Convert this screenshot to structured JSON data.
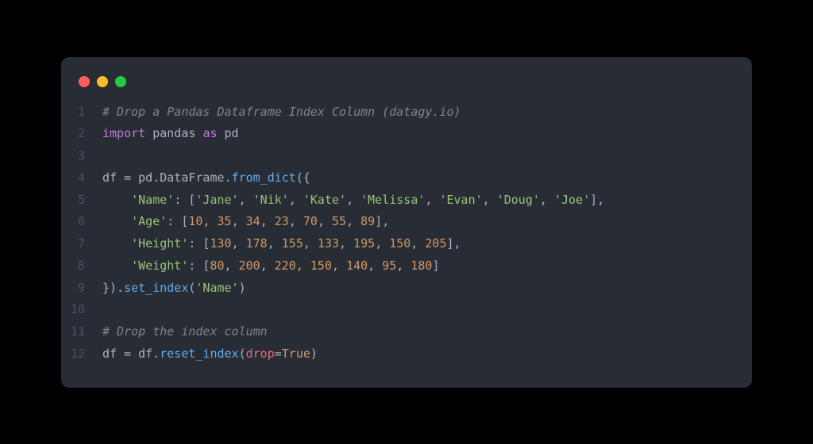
{
  "window": {
    "dots": [
      "red",
      "yellow",
      "green"
    ]
  },
  "code": {
    "lines": [
      {
        "n": "1",
        "tokens": [
          {
            "cls": "tok-comment",
            "t": "# Drop a Pandas Dataframe Index Column (datagy.io)"
          }
        ]
      },
      {
        "n": "2",
        "tokens": [
          {
            "cls": "tok-keyword",
            "t": "import"
          },
          {
            "cls": "tok-default",
            "t": " pandas "
          },
          {
            "cls": "tok-keyword",
            "t": "as"
          },
          {
            "cls": "tok-default",
            "t": " pd"
          }
        ]
      },
      {
        "n": "3",
        "tokens": []
      },
      {
        "n": "4",
        "tokens": [
          {
            "cls": "tok-default",
            "t": "df "
          },
          {
            "cls": "tok-punct",
            "t": "= "
          },
          {
            "cls": "tok-default",
            "t": "pd"
          },
          {
            "cls": "tok-punct",
            "t": "."
          },
          {
            "cls": "tok-default",
            "t": "DataFrame"
          },
          {
            "cls": "tok-punct",
            "t": "."
          },
          {
            "cls": "tok-func",
            "t": "from_dict"
          },
          {
            "cls": "tok-punct",
            "t": "({"
          }
        ]
      },
      {
        "n": "5",
        "tokens": [
          {
            "cls": "tok-default",
            "t": "    "
          },
          {
            "cls": "tok-string",
            "t": "'Name'"
          },
          {
            "cls": "tok-punct",
            "t": ": ["
          },
          {
            "cls": "tok-string",
            "t": "'Jane'"
          },
          {
            "cls": "tok-punct",
            "t": ", "
          },
          {
            "cls": "tok-string",
            "t": "'Nik'"
          },
          {
            "cls": "tok-punct",
            "t": ", "
          },
          {
            "cls": "tok-string",
            "t": "'Kate'"
          },
          {
            "cls": "tok-punct",
            "t": ", "
          },
          {
            "cls": "tok-string",
            "t": "'Melissa'"
          },
          {
            "cls": "tok-punct",
            "t": ", "
          },
          {
            "cls": "tok-string",
            "t": "'Evan'"
          },
          {
            "cls": "tok-punct",
            "t": ", "
          },
          {
            "cls": "tok-string",
            "t": "'Doug'"
          },
          {
            "cls": "tok-punct",
            "t": ", "
          },
          {
            "cls": "tok-string",
            "t": "'Joe'"
          },
          {
            "cls": "tok-punct",
            "t": "],"
          }
        ]
      },
      {
        "n": "6",
        "tokens": [
          {
            "cls": "tok-default",
            "t": "    "
          },
          {
            "cls": "tok-string",
            "t": "'Age'"
          },
          {
            "cls": "tok-punct",
            "t": ": ["
          },
          {
            "cls": "tok-number",
            "t": "10"
          },
          {
            "cls": "tok-punct",
            "t": ", "
          },
          {
            "cls": "tok-number",
            "t": "35"
          },
          {
            "cls": "tok-punct",
            "t": ", "
          },
          {
            "cls": "tok-number",
            "t": "34"
          },
          {
            "cls": "tok-punct",
            "t": ", "
          },
          {
            "cls": "tok-number",
            "t": "23"
          },
          {
            "cls": "tok-punct",
            "t": ", "
          },
          {
            "cls": "tok-number",
            "t": "70"
          },
          {
            "cls": "tok-punct",
            "t": ", "
          },
          {
            "cls": "tok-number",
            "t": "55"
          },
          {
            "cls": "tok-punct",
            "t": ", "
          },
          {
            "cls": "tok-number",
            "t": "89"
          },
          {
            "cls": "tok-punct",
            "t": "],"
          }
        ]
      },
      {
        "n": "7",
        "tokens": [
          {
            "cls": "tok-default",
            "t": "    "
          },
          {
            "cls": "tok-string",
            "t": "'Height'"
          },
          {
            "cls": "tok-punct",
            "t": ": ["
          },
          {
            "cls": "tok-number",
            "t": "130"
          },
          {
            "cls": "tok-punct",
            "t": ", "
          },
          {
            "cls": "tok-number",
            "t": "178"
          },
          {
            "cls": "tok-punct",
            "t": ", "
          },
          {
            "cls": "tok-number",
            "t": "155"
          },
          {
            "cls": "tok-punct",
            "t": ", "
          },
          {
            "cls": "tok-number",
            "t": "133"
          },
          {
            "cls": "tok-punct",
            "t": ", "
          },
          {
            "cls": "tok-number",
            "t": "195"
          },
          {
            "cls": "tok-punct",
            "t": ", "
          },
          {
            "cls": "tok-number",
            "t": "150"
          },
          {
            "cls": "tok-punct",
            "t": ", "
          },
          {
            "cls": "tok-number",
            "t": "205"
          },
          {
            "cls": "tok-punct",
            "t": "],"
          }
        ]
      },
      {
        "n": "8",
        "tokens": [
          {
            "cls": "tok-default",
            "t": "    "
          },
          {
            "cls": "tok-string",
            "t": "'Weight'"
          },
          {
            "cls": "tok-punct",
            "t": ": ["
          },
          {
            "cls": "tok-number",
            "t": "80"
          },
          {
            "cls": "tok-punct",
            "t": ", "
          },
          {
            "cls": "tok-number",
            "t": "200"
          },
          {
            "cls": "tok-punct",
            "t": ", "
          },
          {
            "cls": "tok-number",
            "t": "220"
          },
          {
            "cls": "tok-punct",
            "t": ", "
          },
          {
            "cls": "tok-number",
            "t": "150"
          },
          {
            "cls": "tok-punct",
            "t": ", "
          },
          {
            "cls": "tok-number",
            "t": "140"
          },
          {
            "cls": "tok-punct",
            "t": ", "
          },
          {
            "cls": "tok-number",
            "t": "95"
          },
          {
            "cls": "tok-punct",
            "t": ", "
          },
          {
            "cls": "tok-number",
            "t": "180"
          },
          {
            "cls": "tok-punct",
            "t": "]"
          }
        ]
      },
      {
        "n": "9",
        "tokens": [
          {
            "cls": "tok-punct",
            "t": "})."
          },
          {
            "cls": "tok-func",
            "t": "set_index"
          },
          {
            "cls": "tok-punct",
            "t": "("
          },
          {
            "cls": "tok-string",
            "t": "'Name'"
          },
          {
            "cls": "tok-punct",
            "t": ")"
          }
        ]
      },
      {
        "n": "10",
        "tokens": []
      },
      {
        "n": "11",
        "tokens": [
          {
            "cls": "tok-comment",
            "t": "# Drop the index column"
          }
        ]
      },
      {
        "n": "12",
        "tokens": [
          {
            "cls": "tok-default",
            "t": "df "
          },
          {
            "cls": "tok-punct",
            "t": "= "
          },
          {
            "cls": "tok-default",
            "t": "df"
          },
          {
            "cls": "tok-punct",
            "t": "."
          },
          {
            "cls": "tok-func",
            "t": "reset_index"
          },
          {
            "cls": "tok-punct",
            "t": "("
          },
          {
            "cls": "tok-param",
            "t": "drop"
          },
          {
            "cls": "tok-punct",
            "t": "="
          },
          {
            "cls": "tok-const",
            "t": "True"
          },
          {
            "cls": "tok-punct",
            "t": ")"
          }
        ]
      }
    ]
  }
}
